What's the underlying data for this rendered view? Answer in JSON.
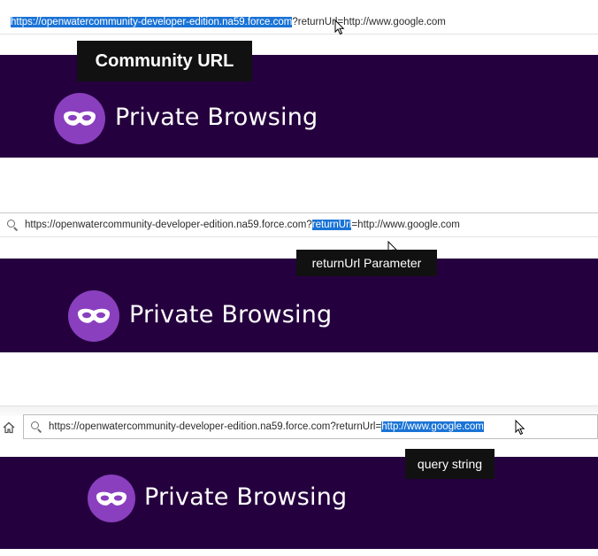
{
  "panels": [
    {
      "url_parts": [
        {
          "text": "https://openwatercommunity-developer-edition.na59.force.com",
          "highlight": true
        },
        {
          "text": "?returnUrl=http://www.google.com",
          "highlight": false
        }
      ],
      "callout": "Community URL",
      "banner_title": "Private Browsing"
    },
    {
      "url_parts": [
        {
          "text": "https://openwatercommunity-developer-edition.na59.force.com?",
          "highlight": false
        },
        {
          "text": "returnUrl",
          "highlight": true
        },
        {
          "text": "=http://www.google.com",
          "highlight": false
        }
      ],
      "callout": "returnUrl Parameter",
      "banner_title": "Private Browsing"
    },
    {
      "url_parts": [
        {
          "text": "https://openwatercommunity-developer-edition.na59.force.com?returnUrl=",
          "highlight": false
        },
        {
          "text": "http://www.google.com",
          "highlight": true
        }
      ],
      "callout": "query string",
      "banner_title": "Private Browsing"
    }
  ],
  "icons": {
    "search": "search-icon",
    "home": "home-icon",
    "cursor": "mouse-cursor-icon",
    "logo": "private-browsing-mask-icon"
  },
  "colors": {
    "banner_bg": "#25003e",
    "logo_bg": "#8a3fbf",
    "selection": "#1a73d6",
    "callout_bg": "#111111"
  }
}
